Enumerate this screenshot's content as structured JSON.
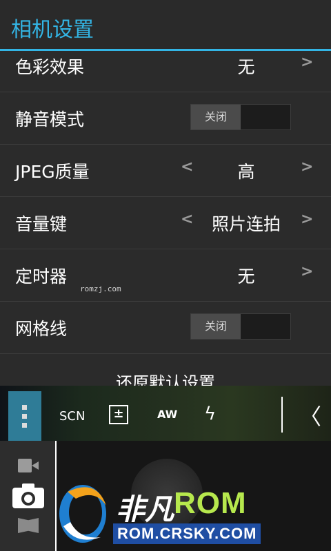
{
  "header": {
    "title": "相机设置"
  },
  "settings": {
    "rows": [
      {
        "label": "色彩效果",
        "value": "无",
        "right": ">"
      },
      {
        "label": "静音模式",
        "toggle": "关闭"
      },
      {
        "label": "JPEG质量",
        "left": "<",
        "value": "高",
        "right": ">"
      },
      {
        "label": "音量键",
        "left": "<",
        "value": "照片连拍",
        "right": ">"
      },
      {
        "label": "定时器",
        "value": "无",
        "right": ">"
      },
      {
        "label": "网格线",
        "toggle": "关闭"
      }
    ],
    "reset_label": "还原默认设置"
  },
  "toolbar": {
    "scn_label": "SCN",
    "ev_label": "±",
    "awb_label": "AW",
    "flash_label": "ϟ",
    "collapse_label": "〈"
  },
  "watermark": {
    "small": "romzj.com",
    "brand_cn": "非凡",
    "brand_rom": "ROM",
    "url": "ROM.CRSKY.COM"
  },
  "colors": {
    "accent": "#33b5e5",
    "toolbar_menu": "#2f7c97",
    "logo_green": "#b6e84d",
    "logo_blue": "#1f4ea3"
  }
}
